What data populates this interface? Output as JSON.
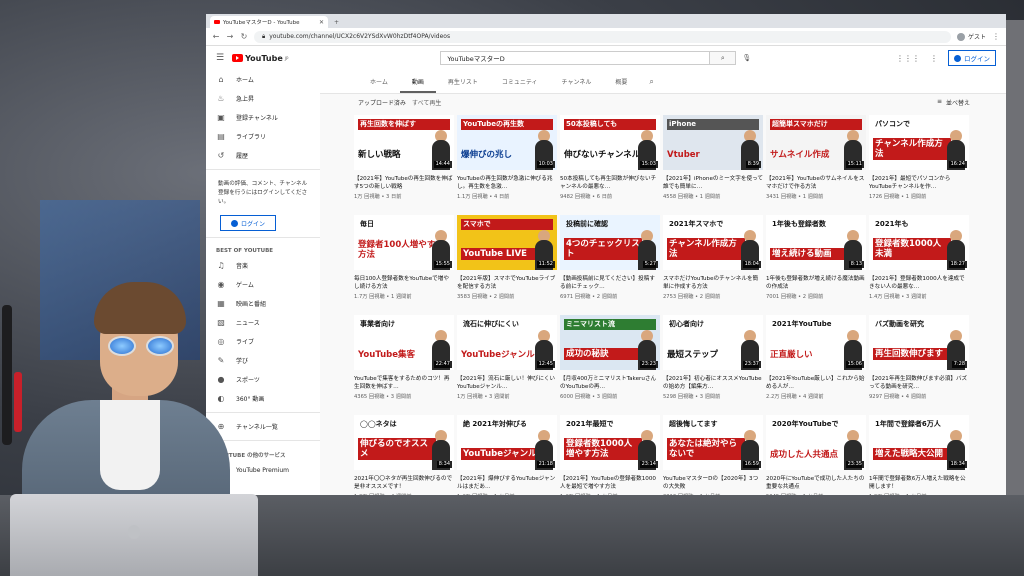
{
  "browser": {
    "tab_title": "YouTubeマスターD - YouTube",
    "url": "youtube.com/channel/UCX2c6V2YSdXvW0hzDtf4OPA/videos",
    "profile_label": "ゲスト"
  },
  "youtube": {
    "logo": "YouTube",
    "logo_region": "JP",
    "search_value": "YouTubeマスターD",
    "login_label": "ログイン"
  },
  "sidebar": {
    "items": [
      {
        "label": "ホーム",
        "icon": "home-icon",
        "glyph": "⌂"
      },
      {
        "label": "急上昇",
        "icon": "flame-icon",
        "glyph": "♨"
      },
      {
        "label": "登録チャンネル",
        "icon": "subscriptions-icon",
        "glyph": "▣"
      },
      {
        "label": "ライブラリ",
        "icon": "library-icon",
        "glyph": "▤"
      },
      {
        "label": "履歴",
        "icon": "history-icon",
        "glyph": "↺"
      }
    ],
    "note": "動画の評価、コメント、チャンネル登録を行うにはログインしてください。",
    "login_label": "ログイン",
    "best_heading": "BEST OF YOUTUBE",
    "best_items": [
      {
        "label": "音楽",
        "icon": "music-icon",
        "glyph": "♫"
      },
      {
        "label": "ゲーム",
        "icon": "game-icon",
        "glyph": "◉"
      },
      {
        "label": "映画と番組",
        "icon": "movie-icon",
        "glyph": "▦"
      },
      {
        "label": "ニュース",
        "icon": "news-icon",
        "glyph": "▧"
      },
      {
        "label": "ライブ",
        "icon": "live-icon",
        "glyph": "◎"
      },
      {
        "label": "学び",
        "icon": "learning-icon",
        "glyph": "✎"
      },
      {
        "label": "スポーツ",
        "icon": "sports-icon",
        "glyph": "●"
      },
      {
        "label": "360° 動画",
        "icon": "360-icon",
        "glyph": "◐"
      }
    ],
    "channel_list": "チャンネル一覧",
    "other_heading": "YOUTUBE の他のサービス",
    "premium": "YouTube Premium"
  },
  "channel": {
    "tabs": [
      "ホーム",
      "動画",
      "再生リスト",
      "コミュニティ",
      "チャンネル",
      "概要"
    ],
    "active_tab": 1,
    "uploads_label": "アップロード済み",
    "all_label": "すべて再生",
    "sort_label": "並べ替え"
  },
  "videos": [
    {
      "t1": "再生回数を伸ばす",
      "t2": "新しい戦略",
      "bg": "#ffffff",
      "t1c": "#fff",
      "t1bg": "#c21a1a",
      "t2c": "#111",
      "dur": "14:44",
      "title": "【2021年】YouTubeの再生回数を伸ばす5つの新しい戦略",
      "meta": "1万 回視聴 • 3 日前"
    },
    {
      "t1": "YouTubeの再生数",
      "t2": "爆伸びの兆し",
      "bg": "#e9f3ff",
      "t1c": "#fff",
      "t1bg": "#c21a1a",
      "t2c": "#0b3d91",
      "dur": "10:03",
      "title": "YouTubeの再生回数が急激に伸びる兆し。再生数を急激…",
      "meta": "1.1万 回視聴 • 4 日前"
    },
    {
      "t1": "50本投稿しても",
      "t2": "伸びないチャンネル",
      "bg": "#ffffff",
      "t1c": "#fff",
      "t1bg": "#c21a1a",
      "t2c": "#111",
      "dur": "15:03",
      "title": "50本投稿しても再生回数が伸びないチャンネルの最悪な…",
      "meta": "9482 回視聴 • 6 日前"
    },
    {
      "t1": "iPhone",
      "t2": "Vtuber",
      "bg": "#dfe6ee",
      "t1c": "#fff",
      "t1bg": "#555",
      "t2c": "#c21a1a",
      "dur": "8:39",
      "title": "【2021年】iPhoneのミー文字を使って誰でも簡単に…",
      "meta": "4558 回視聴 • 1 週間前"
    },
    {
      "t1": "超簡単スマホだけ",
      "t2": "サムネイル作成",
      "bg": "#f4f4f4",
      "t1c": "#fff",
      "t1bg": "#c21a1a",
      "t2c": "#c21a1a",
      "dur": "15:11",
      "title": "【2021年】YouTubeのサムネイルをスマホだけで作る方法",
      "meta": "3431 回視聴 • 1 週間前"
    },
    {
      "t1": "パソコンで",
      "t2": "チャンネル作成方法",
      "bg": "#ffffff",
      "t1c": "#111",
      "t1bg": "transparent",
      "t2c": "#fff",
      "dur": "16:24",
      "title": "【2021年】最短でパソコンからYouTubeチャンネルを作…",
      "meta": "1726 回視聴 • 1 週間前"
    },
    {
      "t1": "毎日",
      "t2": "登録者100人増やす方法",
      "bg": "#ffffff",
      "t1c": "#111",
      "t1bg": "transparent",
      "t2c": "#c21a1a",
      "dur": "15:55",
      "title": "毎日100人登録者数をYouTubeで増やし続ける方法",
      "meta": "1.7万 回視聴 • 1 週間前"
    },
    {
      "t1": "スマホで",
      "t2": "YouTube LIVE",
      "bg": "#f2c318",
      "t1c": "#fff",
      "t1bg": "#c21a1a",
      "t2c": "#fff",
      "dur": "11:52",
      "title": "【2021年版】スマホでYouTubeライブを配信する方法",
      "meta": "3583 回視聴 • 2 週間前"
    },
    {
      "t1": "投稿前に確認",
      "t2": "4つのチェックリスト",
      "bg": "#eaf4ff",
      "t1c": "#111",
      "t1bg": "transparent",
      "t2c": "#fff",
      "dur": "5:27",
      "title": "【動画投稿前に見てください】投稿する前にチェック…",
      "meta": "6971 回視聴 • 2 週間前"
    },
    {
      "t1": "2021年スマホで",
      "t2": "チャンネル作成方法",
      "bg": "#ffffff",
      "t1c": "#111",
      "t1bg": "transparent",
      "t2c": "#fff",
      "dur": "18:04",
      "title": "スマホだけYouTubeのチャンネルを簡単に作成する方法",
      "meta": "2753 回視聴 • 2 週間前"
    },
    {
      "t1": "1年後も登録者数",
      "t2": "増え続ける動画",
      "bg": "#ffffff",
      "t1c": "#111",
      "t1bg": "transparent",
      "t2c": "#fff",
      "dur": "8:13",
      "title": "1年後も登録者数が増え続ける魔法動画の作成法",
      "meta": "7001 回視聴 • 2 週間前"
    },
    {
      "t1": "2021年も",
      "t2": "登録者数1000人未満",
      "bg": "#ffffff",
      "t1c": "#111",
      "t1bg": "transparent",
      "t2c": "#fff",
      "dur": "18:27",
      "title": "【2021年】登録者数1000人を達成できない人の最悪な…",
      "meta": "1.4万 回視聴 • 3 週間前"
    },
    {
      "t1": "事業者向け",
      "t2": "YouTube集客",
      "bg": "#ffffff",
      "t1c": "#111",
      "t1bg": "transparent",
      "t2c": "#c21a1a",
      "dur": "22:47",
      "title": "YouTubeで集客をするためのコツ！再生回数を伸ばす…",
      "meta": "4365 回視聴 • 3 週間前"
    },
    {
      "t1": "流石に伸びにくい",
      "t2": "YouTubeジャンル",
      "bg": "#ffffff",
      "t1c": "#111",
      "t1bg": "transparent",
      "t2c": "#c21a1a",
      "dur": "12:45",
      "title": "【2021年】流石に厳しい！伸びにくいYouTubeジャンル…",
      "meta": "1万 回視聴 • 3 週間前"
    },
    {
      "t1": "ミニマリスト流",
      "t2": "成功の秘訣",
      "bg": "#dbe7f2",
      "t1c": "#fff",
      "t1bg": "#2e7d32",
      "t2c": "#fff",
      "dur": "23:23",
      "title": "【月収400万ミニマリストTakeruさんのYouTubeの再…",
      "meta": "6000 回視聴 • 3 週間前"
    },
    {
      "t1": "初心者向け",
      "t2": "最短ステップ",
      "bg": "#ffffff",
      "t1c": "#111",
      "t1bg": "transparent",
      "t2c": "#111",
      "dur": "23:37",
      "title": "【2021年】初心者にオススメYouTubeの始め方【編集方…",
      "meta": "5298 回視聴 • 3 週間前"
    },
    {
      "t1": "2021年YouTube",
      "t2": "正直厳しい",
      "bg": "#ffffff",
      "t1c": "#111",
      "t1bg": "transparent",
      "t2c": "#c21a1a",
      "dur": "15:06",
      "title": "【2021年YouTube厳しい】これから始める人が…",
      "meta": "2.2万 回視聴 • 4 週間前"
    },
    {
      "t1": "バズ動画を研究",
      "t2": "再生回数伸びます",
      "bg": "#ffffff",
      "t1c": "#111",
      "t1bg": "transparent",
      "t2c": "#fff",
      "dur": "7:28",
      "title": "【2021年再生回数伸びます必須】バズってる動画を研究…",
      "meta": "9297 回視聴 • 4 週間前"
    },
    {
      "t1": "◯◯ネタは",
      "t2": "伸びるのでオススメ",
      "bg": "#ffffff",
      "t1c": "#111",
      "t1bg": "transparent",
      "t2c": "#fff",
      "dur": "8:34",
      "title": "2021年〇〇ネタが再生回数伸びるので是非オススメです！",
      "meta": "1.2万 回視聴 • 4 週間前"
    },
    {
      "t1": "絶 2021年対伸びる",
      "t2": "YouTubeジャンル",
      "bg": "#ffffff",
      "t1c": "#111",
      "t1bg": "transparent",
      "t2c": "#fff",
      "dur": "21:18",
      "title": "【2021年】爆伸びするYouTubeジャンルはまだあ…",
      "meta": "1.4万 回視聴 • 1 か月前"
    },
    {
      "t1": "2021年最短で",
      "t2": "登録者数1000人増やす方法",
      "bg": "#ffffff",
      "t1c": "#111",
      "t1bg": "transparent",
      "t2c": "#fff",
      "dur": "23:14",
      "title": "【2021年】YouTubeの登録者数1000人を最短で増やす方法",
      "meta": "1.4万 回視聴 • 1 か月前"
    },
    {
      "t1": "超後悔してます",
      "t2": "あなたは絶対やらないで",
      "bg": "#ffffff",
      "t1c": "#111",
      "t1bg": "transparent",
      "t2c": "#fff",
      "dur": "16:59",
      "title": "YouTubeマスターDの【2020年】3つの大失敗",
      "meta": "2313 回視聴 • 1 か月前"
    },
    {
      "t1": "2020年YouTubeで",
      "t2": "成功した人共通点",
      "bg": "#ffffff",
      "t1c": "#111",
      "t1bg": "transparent",
      "t2c": "#c21a1a",
      "dur": "23:35",
      "title": "2020年にYouTubeで成功した人たちの重要な共通点",
      "meta": "5045 回視聴 • 1 か月前"
    },
    {
      "t1": "1年間で登録者6万人",
      "t2": "増えた戦略大公開",
      "bg": "#ffffff",
      "t1c": "#111",
      "t1bg": "transparent",
      "t2c": "#fff",
      "dur": "18:34",
      "title": "1年間で登録者数6万人増えた戦略を公開します！",
      "meta": "1.9万 回視聴 • 1 か月前"
    }
  ]
}
